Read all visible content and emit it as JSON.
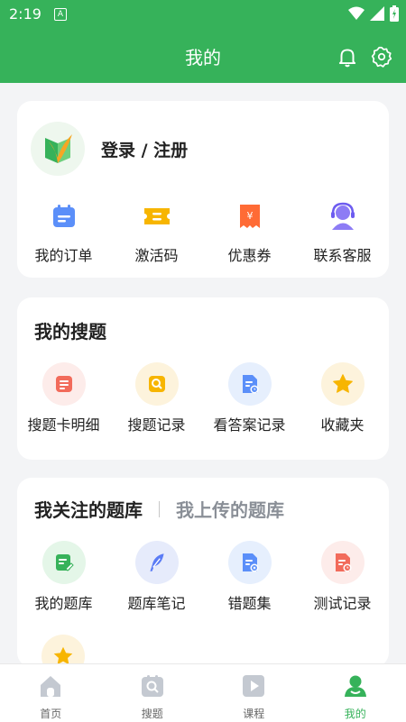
{
  "status_bar": {
    "time": "2:19",
    "ime_label": "A"
  },
  "header": {
    "title": "我的"
  },
  "account": {
    "login_label": "登录 / 注册"
  },
  "quick_actions": [
    {
      "label": "我的订单",
      "icon": "calendar-icon"
    },
    {
      "label": "激活码",
      "icon": "ticket-icon"
    },
    {
      "label": "优惠券",
      "icon": "coupon-icon"
    },
    {
      "label": "联系客服",
      "icon": "headset-icon"
    }
  ],
  "search_section": {
    "title": "我的搜题",
    "items": [
      {
        "label": "搜题卡明细",
        "icon": "card-detail-icon"
      },
      {
        "label": "搜题记录",
        "icon": "search-record-icon"
      },
      {
        "label": "看答案记录",
        "icon": "answer-record-icon"
      },
      {
        "label": "收藏夹",
        "icon": "star-icon"
      }
    ]
  },
  "bank_section": {
    "tab_active": "我关注的题库",
    "tab_inactive": "我上传的题库",
    "items": [
      {
        "label": "我的题库",
        "icon": "edit-doc-icon"
      },
      {
        "label": "题库笔记",
        "icon": "feather-icon"
      },
      {
        "label": "错题集",
        "icon": "wrong-doc-icon"
      },
      {
        "label": "测试记录",
        "icon": "test-record-icon"
      }
    ]
  },
  "bottom_nav": [
    {
      "label": "首页",
      "icon": "home-icon"
    },
    {
      "label": "搜题",
      "icon": "search-icon"
    },
    {
      "label": "课程",
      "icon": "play-icon"
    },
    {
      "label": "我的",
      "icon": "profile-icon",
      "active": true
    }
  ],
  "colors": {
    "brand_green": "#36b25a"
  }
}
